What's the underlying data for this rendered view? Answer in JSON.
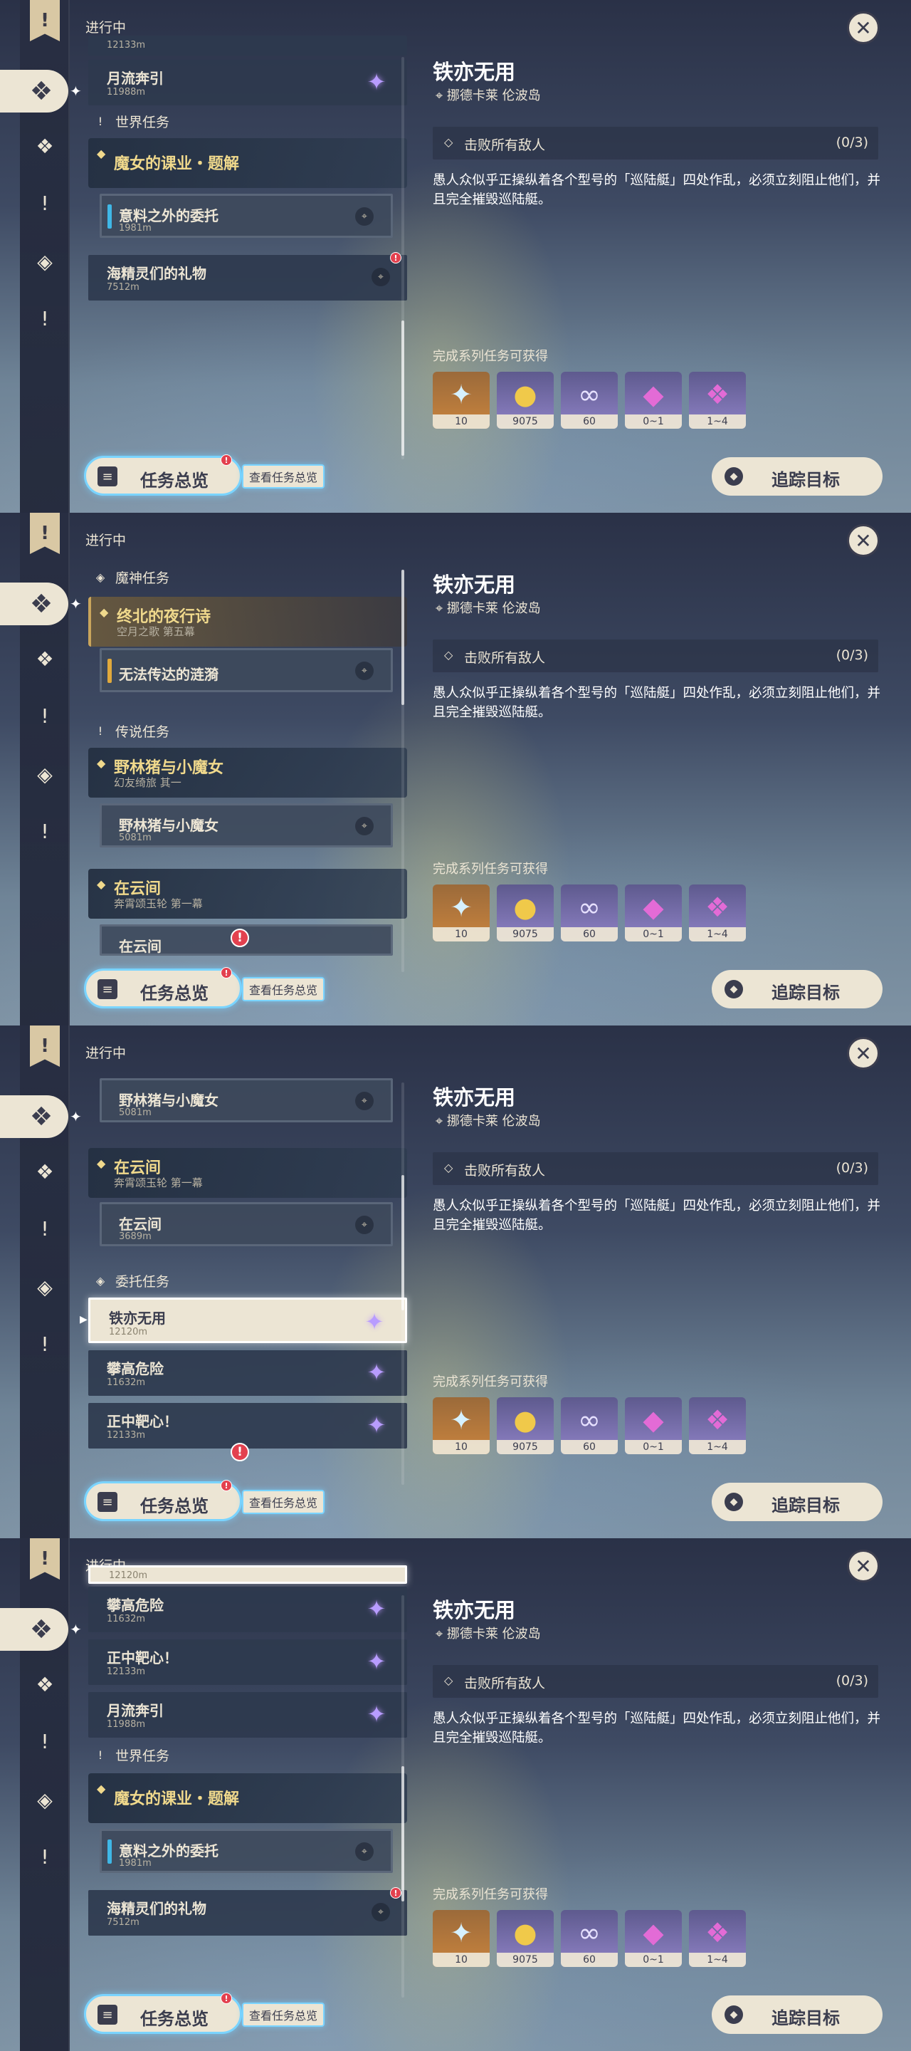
{
  "header": {
    "in_progress": "进行中"
  },
  "rail": {
    "top_icon": "!",
    "items": [
      "compass-icon",
      "exclaim-icon",
      "diamond-icon",
      "exclaim-icon"
    ]
  },
  "sections": {
    "archon": "魔神任务",
    "legend": "传说任务",
    "commission": "委托任务",
    "world": "世界任务"
  },
  "quests": {
    "archon_main": {
      "title": "终北的夜行诗",
      "subtitle": "空月之歌 第五幕"
    },
    "archon_sub": {
      "title": "无法传达的涟漪"
    },
    "legend1": {
      "title": "野林猪与小魔女",
      "subtitle": "幻友绮旅 其一"
    },
    "legend1_sub": {
      "title": "野林猪与小魔女",
      "distance": "5081m"
    },
    "legend2": {
      "title": "在云间",
      "subtitle": "奔霄颂玉轮 第一幕"
    },
    "legend2_sub": {
      "title": "在云间",
      "distance": "3689m"
    },
    "com1": {
      "title": "铁亦无用",
      "distance": "12120m"
    },
    "com2": {
      "title": "攀高危险",
      "distance": "11632m"
    },
    "com3": {
      "title": "正中靶心！",
      "distance": "12133m"
    },
    "com4": {
      "title": "月流奔引",
      "distance": "11988m"
    },
    "world1": {
      "title": "魔女的课业・题解"
    },
    "world1_sub": {
      "title": "意料之外的委托",
      "distance": "1981m"
    },
    "world2": {
      "title": "海精灵们的礼物",
      "distance": "7512m"
    }
  },
  "footer": {
    "overview": "任务总览",
    "overview_link": "查看任务总览",
    "track": "追踪目标"
  },
  "detail": {
    "title": "铁亦无用",
    "location": "挪德卡莱 伦波岛",
    "objective": "击败所有敌人",
    "progress": "(0/3)",
    "description": "愚人众似乎正操纵着各个型号的「巡陆艇」四处作乱，必须立刻阻止他们，并且完全摧毁巡陆艇。",
    "rewards_label": "完成系列任务可获得",
    "rewards": [
      {
        "icon": "primogem-icon",
        "qty": "10"
      },
      {
        "icon": "mora-icon",
        "qty": "9075"
      },
      {
        "icon": "fellowship-icon",
        "qty": "60"
      },
      {
        "icon": "crystal-icon",
        "qty": "0~1"
      },
      {
        "icon": "crystal-cluster-icon",
        "qty": "1~4"
      }
    ]
  },
  "colors": {
    "accent": "#ece5d4",
    "gold": "#f0d98c",
    "alert": "#e3414f",
    "glow": "#7ad4ff"
  }
}
